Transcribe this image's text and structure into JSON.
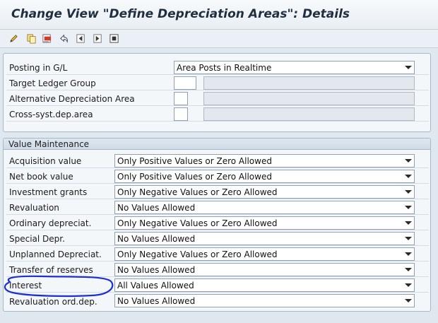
{
  "window": {
    "title": "Change View \"Define Depreciation Areas\": Details"
  },
  "toolbar": {
    "buttons": [
      {
        "icon": "edit-pencil-icon"
      },
      {
        "icon": "copy-icon"
      },
      {
        "icon": "delete-icon"
      },
      {
        "icon": "undo-icon"
      },
      {
        "icon": "previous-entry-icon"
      },
      {
        "icon": "next-entry-icon"
      },
      {
        "icon": "select-icon"
      }
    ]
  },
  "general_group": {
    "fields": [
      {
        "label": "Posting in G/L",
        "value": "Area Posts in Realtime"
      },
      {
        "label": "Target Ledger Group",
        "value": ""
      },
      {
        "label": "Alternative Depreciation Area",
        "value": ""
      },
      {
        "label": "Cross-syst.dep.area",
        "value": ""
      }
    ]
  },
  "value_maintenance": {
    "title": "Value Maintenance",
    "fields": [
      {
        "label": "Acquisition value",
        "value": "Only Positive Values or Zero Allowed"
      },
      {
        "label": "Net book value",
        "value": "Only Positive Values or Zero Allowed"
      },
      {
        "label": "Investment grants",
        "value": "Only Negative Values or Zero Allowed"
      },
      {
        "label": "Revaluation",
        "value": "No Values Allowed"
      },
      {
        "label": "Ordinary depreciat.",
        "value": "Only Negative Values or Zero Allowed"
      },
      {
        "label": "Special Depr.",
        "value": "No Values Allowed"
      },
      {
        "label": "Unplanned Depreciat.",
        "value": "Only Negative Values or Zero Allowed"
      },
      {
        "label": "Transfer of reserves",
        "value": "No Values Allowed"
      },
      {
        "label": "Interest",
        "value": "All Values Allowed"
      },
      {
        "label": "Revaluation ord.dep.",
        "value": "No Values Allowed"
      }
    ]
  },
  "annotation": {
    "color": "#1a2fd6",
    "target": "Interest"
  }
}
